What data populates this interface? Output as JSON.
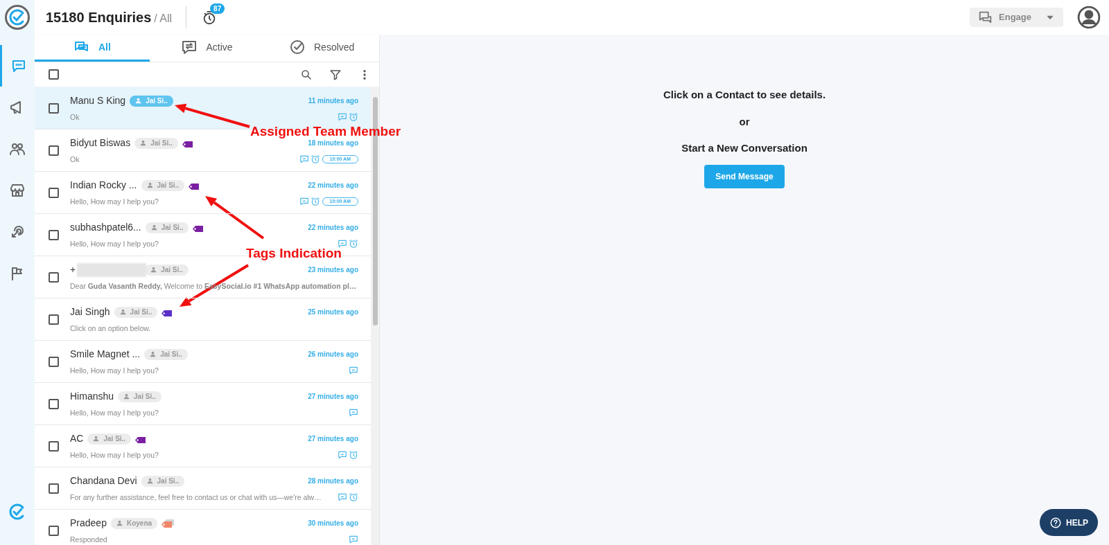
{
  "header": {
    "title": "15180 Enquiries",
    "filter": "/ All",
    "timer_badge": "87",
    "engage": "Engage"
  },
  "sidebar": {
    "items": [
      {
        "selected": true
      },
      {
        "selected": false
      },
      {
        "selected": false
      },
      {
        "selected": false
      },
      {
        "selected": false
      },
      {
        "selected": false
      }
    ]
  },
  "tabs": [
    {
      "label": "All",
      "selected": true
    },
    {
      "label": "Active",
      "selected": false
    },
    {
      "label": "Resolved",
      "selected": false
    }
  ],
  "select_all": {
    "checked": false
  },
  "conversations": [
    {
      "name": "Manu S King",
      "assignee": "Jai Si..",
      "time": "11 minutes ago",
      "preview": "Ok",
      "chat": true,
      "alarm": true,
      "checked": false,
      "selected": true
    },
    {
      "name": "Bidyut Biswas",
      "assignee": "Jai Si..",
      "tags": [
        {
          "color": "#7b1fa2"
        }
      ],
      "time": "18 minutes ago",
      "preview": "Ok",
      "chat": true,
      "alarm": true,
      "reminder": "10:00 AM",
      "checked": false,
      "selected": false
    },
    {
      "name": "Indian Rocky ...",
      "assignee": "Jai Si..",
      "tags": [
        {
          "color": "#7b1fa2"
        }
      ],
      "time": "22 minutes ago",
      "preview": "Hello, How may I help you?",
      "chat": true,
      "alarm": true,
      "reminder": "10:00 AM",
      "checked": false,
      "selected": false
    },
    {
      "name": "subhashpatel6...",
      "assignee": "Jai Si..",
      "tags": [
        {
          "color": "#7b1fa2"
        }
      ],
      "time": "22 minutes ago",
      "preview": "Hello, How may I help you?",
      "chat": true,
      "alarm": true,
      "checked": false,
      "selected": false
    },
    {
      "name": "+",
      "masked": true,
      "assignee": "Jai Si..",
      "time": "23 minutes ago",
      "preview": "Dear **Guda Vasanth Reddy,** Welcome to **EasySocial.io #1 WhatsApp automation pl…**",
      "chat": false,
      "alarm": false,
      "checked": false,
      "selected": false
    },
    {
      "name": "Jai Singh",
      "assignee": "Jai Si..",
      "tags": [
        {
          "color": "#5b30c8"
        }
      ],
      "time": "25 minutes ago",
      "preview": "Click on an option below.",
      "chat": false,
      "alarm": false,
      "checked": false,
      "selected": false
    },
    {
      "name": "Smile Magnet ...",
      "assignee": "Jai Si..",
      "time": "26 minutes ago",
      "preview": "Hello, How may I help you?",
      "chat": true,
      "alarm": false,
      "checked": false,
      "selected": false
    },
    {
      "name": "Himanshu",
      "assignee": "Jai Si..",
      "time": "27 minutes ago",
      "preview": "Hello, How may I help you?",
      "chat": true,
      "alarm": false,
      "checked": false,
      "selected": false
    },
    {
      "name": "AC",
      "assignee": "Jai Si..",
      "tags": [
        {
          "color": "#7b1fa2"
        }
      ],
      "time": "27 minutes ago",
      "preview": "Hello, How may I help you?",
      "chat": true,
      "alarm": true,
      "checked": false,
      "selected": false
    },
    {
      "name": "Chandana Devi",
      "assignee": "Jai Si..",
      "time": "28 minutes ago",
      "preview": "For any further assistance, feel free to contact us or chat with us—we're alw…",
      "chat": true,
      "alarm": true,
      "checked": false,
      "selected": false
    },
    {
      "name": "Pradeep",
      "assignee": "Koyena",
      "tags": [
        {
          "color": "#f0866a"
        },
        {
          "color": "#d4d4d4"
        }
      ],
      "time": "30 minutes ago",
      "preview": "Responded",
      "chat": true,
      "alarm": false,
      "checked": false,
      "selected": false
    }
  ],
  "detail": {
    "line1": "Click on a Contact to see details.",
    "line2": "or",
    "line3": "Start a New Conversation",
    "button": "Send Message"
  },
  "help": "HELP",
  "annotations": [
    "Assigned Team Member",
    "Tags Indication"
  ]
}
